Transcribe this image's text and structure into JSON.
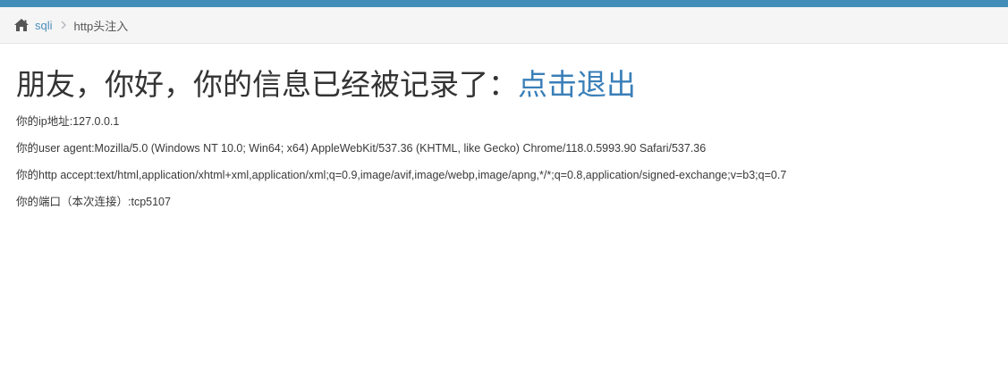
{
  "breadcrumb": {
    "home_label": "sqli",
    "current": "http头注入"
  },
  "main": {
    "greeting": "朋友，你好，你的信息已经被记录了：",
    "logout_link": "点击退出",
    "info": [
      "你的ip地址:127.0.0.1",
      "你的user agent:Mozilla/5.0 (Windows NT 10.0; Win64; x64) AppleWebKit/537.36 (KHTML, like Gecko) Chrome/118.0.5993.90 Safari/537.36",
      "你的http accept:text/html,application/xhtml+xml,application/xml;q=0.9,image/avif,image/webp,image/apng,*/*;q=0.8,application/signed-exchange;v=b3;q=0.7",
      "你的端口（本次连接）:tcp5107"
    ]
  },
  "icons": {
    "home": "home-icon",
    "separator": "chevron-right-icon"
  },
  "colors": {
    "top_bar": "#438eb9",
    "link": "#4c8fbd",
    "logout_link": "#3a7fb8"
  }
}
